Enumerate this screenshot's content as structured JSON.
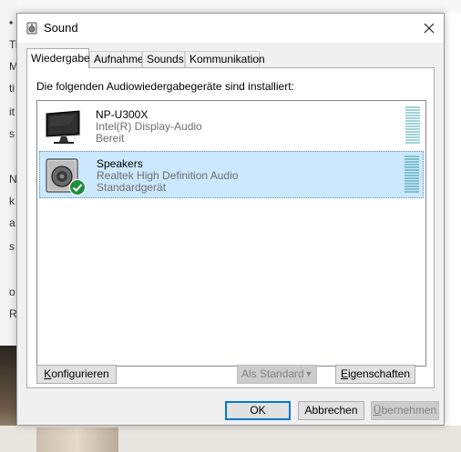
{
  "window": {
    "title": "Sound"
  },
  "tabs": [
    {
      "label": "Wiedergabe",
      "active": true
    },
    {
      "label": "Aufnahme",
      "active": false
    },
    {
      "label": "Sounds",
      "active": false
    },
    {
      "label": "Kommunikation",
      "active": false
    }
  ],
  "instruction": "Die folgenden Audiowiedergabegeräte sind installiert:",
  "devices": [
    {
      "name": "NP-U300X",
      "driver": "Intel(R) Display-Audio",
      "status": "Bereit",
      "icon": "monitor-icon",
      "selected": false
    },
    {
      "name": "Speakers",
      "driver": "Realtek High Definition Audio",
      "status": "Standardgerät",
      "icon": "speaker-icon",
      "selected": true
    }
  ],
  "buttons": {
    "configure_u": "K",
    "configure_rest": "onfigurieren",
    "set_default": "Als Standard",
    "properties_u": "E",
    "properties_rest": "igenschaften",
    "ok": "OK",
    "cancel": "Abbrechen",
    "apply_u": "Ü",
    "apply_rest": "bernehmen"
  },
  "background_fragments": [
    "•",
    "Ti",
    "M",
    "ti",
    "it",
    "s",
    "N",
    "k",
    "a",
    "s",
    "o",
    "R"
  ],
  "colors": {
    "selection": "#cce8ff",
    "default_button_border": "#0078d7",
    "check_badge": "#1e8e3e"
  }
}
